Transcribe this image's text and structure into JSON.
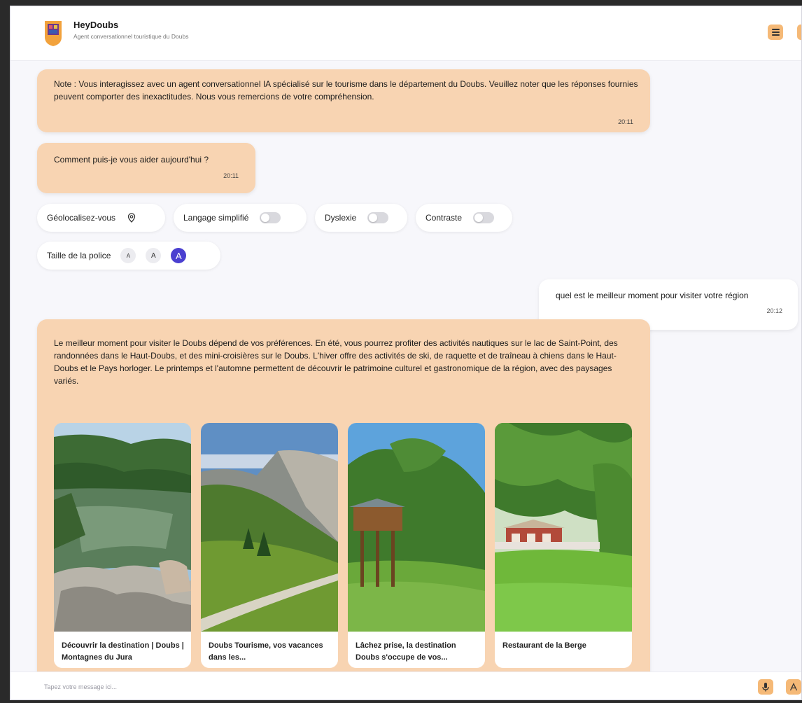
{
  "header": {
    "title": "HeyDoubs",
    "subtitle": "Agent conversationnel touristique du Doubs"
  },
  "messages": {
    "note": {
      "text": "Note : Vous interagissez avec un agent conversationnel IA spécialisé sur le tourisme dans le département du Doubs. Veuillez noter que les réponses fournies peuvent comporter des inexactitudes. Nous vous remercions de votre compréhension.",
      "time": "20:11"
    },
    "greeting": {
      "text": "Comment puis-je vous aider aujourd'hui ?",
      "time": "20:11"
    },
    "user": {
      "text": "quel est le meilleur moment pour visiter votre région",
      "time": "20:12"
    },
    "answer": {
      "text": "Le meilleur moment pour visiter le Doubs dépend de vos préférences. En été, vous pourrez profiter des activités nautiques sur le lac de Saint-Point, des randonnées dans le Haut-Doubs, et des mini-croisières sur le Doubs. L'hiver offre des activités de ski, de raquette et de traîneau à chiens dans le Haut-Doubs et le Pays horloger. Le printemps et l'automne permettent de découvrir le patrimoine culturel et gastronomique de la région, avec des paysages variés."
    }
  },
  "options": {
    "geolocate": "Géolocalisez-vous",
    "simple_language": "Langage simplifié",
    "dyslexia": "Dyslexie",
    "contrast": "Contraste",
    "font_size": "Taille de la police",
    "font_buttons": [
      "A",
      "A",
      "A"
    ]
  },
  "cards": [
    {
      "caption": "Découvrir la destination | Doubs | Montagnes du Jura"
    },
    {
      "caption": "Doubs Tourisme, vos vacances dans les..."
    },
    {
      "caption": "Lâchez prise, la destination Doubs s'occupe de vos..."
    },
    {
      "caption": "Restaurant de la Berge"
    }
  ],
  "input": {
    "placeholder": "Tapez votre message ici..."
  },
  "colors": {
    "bot_bubble": "#f8d4b2",
    "accent": "#f5b977",
    "active_font": "#4a3fd0"
  }
}
